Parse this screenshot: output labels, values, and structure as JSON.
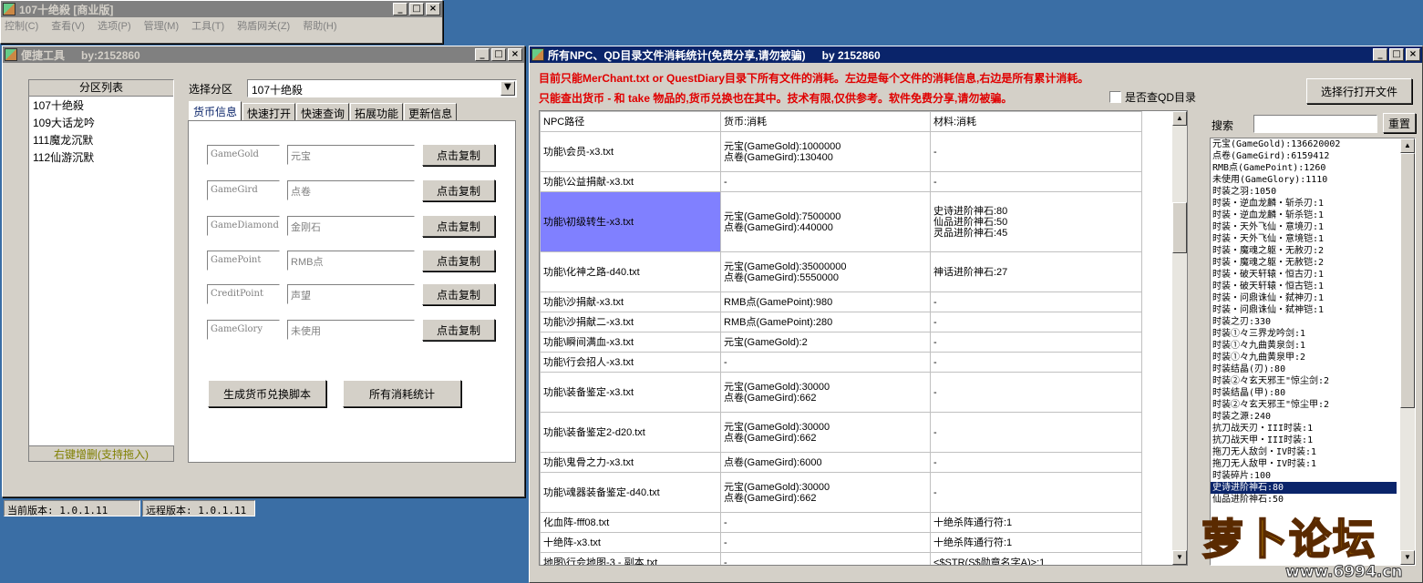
{
  "main_window": {
    "title": "107十绝殺 [商业版]",
    "menus": [
      "控制(C)",
      "查看(V)",
      "选项(P)",
      "管理(M)",
      "工具(T)",
      "鸦盾网关(Z)",
      "帮助(H)"
    ]
  },
  "tools_window": {
    "title": "便捷工具",
    "by": "by:2152860",
    "zone_list_header": "分区列表",
    "zones": [
      "107十绝殺",
      "109大话龙吟",
      "111魔龙沉默",
      "112仙游沉默"
    ],
    "zone_footer": "右键增删(支持拖入)",
    "select_label": "选择分区",
    "select_value": "107十绝殺",
    "tabs": [
      "货币信息",
      "快速打开",
      "快速查询",
      "拓展功能",
      "更新信息"
    ],
    "currency_rows": [
      {
        "code": "GameGold",
        "name": "元宝",
        "button": "点击复制"
      },
      {
        "code": "GameGird",
        "name": "点卷",
        "button": "点击复制"
      },
      {
        "code": "GameDiamond",
        "name": "金刚石",
        "button": "点击复制"
      },
      {
        "code": "GamePoint",
        "name": "RMB点",
        "button": "点击复制"
      },
      {
        "code": "CreditPoint",
        "name": "声望",
        "button": "点击复制"
      },
      {
        "code": "GameGlory",
        "name": "未使用",
        "button": "点击复制"
      }
    ],
    "gen_button": "生成货币兑换脚本",
    "all_button": "所有消耗统计"
  },
  "status": {
    "current": "当前版本: 1.0.1.11",
    "remote": "远程版本: 1.0.1.11"
  },
  "stats_window": {
    "title": "所有NPC、QD目录文件消耗统计(免费分享,请勿被骗)",
    "by": "by 2152860",
    "note1": "目前只能MerChant.txt or QuestDiary目录下所有文件的消耗。左边是每个文件的消耗信息,右边是所有累计消耗。",
    "note2": "只能查出货币 - 和 take 物品的,货币兑换也在其中。技术有限,仅供参考。软件免费分享,请勿被骗。",
    "checkbox_label": "是否查QD目录",
    "open_button": "选择行打开文件",
    "search_label": "搜索",
    "reset_button": "重置",
    "columns": [
      "NPC路径",
      "货币:消耗",
      "材料:消耗"
    ],
    "rows": [
      {
        "path": "功能\\会员-x3.txt",
        "currency": "元宝(GameGold):1000000\n点卷(GameGird):130400",
        "material": "-"
      },
      {
        "path": "功能\\公益捐献-x3.txt",
        "currency": "-",
        "material": "-"
      },
      {
        "path": "功能\\初级转生-x3.txt",
        "currency": "元宝(GameGold):7500000\n点卷(GameGird):440000",
        "material": "史诗进阶神石:80\n仙品进阶神石:50\n灵品进阶神石:45"
      },
      {
        "path": "功能\\化神之路-d40.txt",
        "currency": "元宝(GameGold):35000000\n点卷(GameGird):5550000",
        "material": "神话进阶神石:27"
      },
      {
        "path": "功能\\沙捐献-x3.txt",
        "currency": "RMB点(GamePoint):980",
        "material": "-"
      },
      {
        "path": "功能\\沙捐献二-x3.txt",
        "currency": "RMB点(GamePoint):280",
        "material": "-"
      },
      {
        "path": "功能\\瞬间满血-x3.txt",
        "currency": "元宝(GameGold):2",
        "material": "-"
      },
      {
        "path": "功能\\行会招人-x3.txt",
        "currency": "-",
        "material": "-"
      },
      {
        "path": "功能\\装备鉴定-x3.txt",
        "currency": "元宝(GameGold):30000\n点卷(GameGird):662",
        "material": "-"
      },
      {
        "path": "功能\\装备鉴定2-d20.txt",
        "currency": "元宝(GameGold):30000\n点卷(GameGird):662",
        "material": "-"
      },
      {
        "path": "功能\\鬼骨之力-x3.txt",
        "currency": "点卷(GameGird):6000",
        "material": "-"
      },
      {
        "path": "功能\\魂器装备鉴定-d40.txt",
        "currency": "元宝(GameGold):30000\n点卷(GameGird):662",
        "material": "-"
      },
      {
        "path": "化血阵-fff08.txt",
        "currency": "-",
        "material": "十绝杀阵通行符:1"
      },
      {
        "path": "十绝阵-x3.txt",
        "currency": "-",
        "material": "十绝杀阵通行符:1"
      },
      {
        "path": "地图\\行会地图-3 - 副本.txt",
        "currency": "-",
        "material": "<$STR(S$勋章名字A)>:1"
      }
    ],
    "totals": [
      "元宝(GameGold):136620002",
      "点卷(GameGird):6159412",
      "RMB点(GamePoint):1260",
      "未使用(GameGlory):1110",
      "时装之羽:1050",
      "时装・逆血龙麟・斩杀刃:1",
      "时装・逆血龙麟・斩杀铠:1",
      "时装・天外飞仙・意境刃:1",
      "时装・天外飞仙・意境铠:1",
      "时装・魔魂之躯・无赦刃:2",
      "时装・魔魂之躯・无赦铠:2",
      "时装・破天轩辕・恒古刃:1",
      "时装・破天轩辕・恒古铠:1",
      "时装・问鼎诛仙・弑神刃:1",
      "时装・问鼎诛仙・弑神铠:1",
      "时装之刃:330",
      "时装①々三界龙吟剑:1",
      "时装①々九曲黄泉剑:1",
      "时装①々九曲黄泉甲:2",
      "时装结晶(刃):80",
      "时装②々玄天邪王\"惊尘剑:2",
      "时装结晶(甲):80",
      "时装②々玄天邪王\"惊尘甲:2",
      "时装之源:240",
      "抗刀战天刃・III时装:1",
      "抗刀战天甲・III时装:1",
      "拖刀无人敌剑・IV时装:1",
      "拖刀无人敌甲・IV时装:1",
      "时装碎片:100",
      "史诗进阶神石:80",
      "仙品进阶神石:50"
    ],
    "highlighted_index": 29
  },
  "watermark": {
    "logo_text": "萝卜论坛",
    "url": "www.6994.cn"
  }
}
